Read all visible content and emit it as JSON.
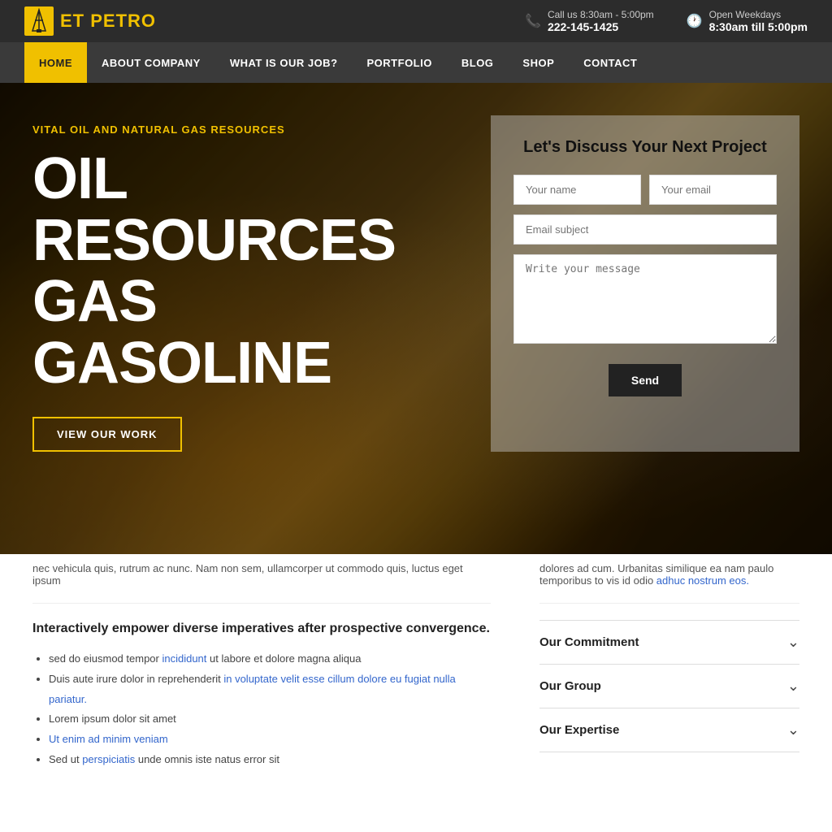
{
  "topbar": {
    "logo_prefix": "ET ",
    "logo_accent": "PETRO",
    "phone_label": "Call us 8:30am - 5:00pm",
    "phone_number": "222-145-1425",
    "hours_label": "Open Weekdays",
    "hours_value": "8:30am till 5:00pm"
  },
  "nav": {
    "items": [
      {
        "label": "HOME",
        "active": true
      },
      {
        "label": "ABOUT COMPANY",
        "active": false
      },
      {
        "label": "WHAT IS OUR JOB?",
        "active": false
      },
      {
        "label": "PORTFOLIO",
        "active": false
      },
      {
        "label": "BLOG",
        "active": false
      },
      {
        "label": "SHOP",
        "active": false
      },
      {
        "label": "CONTACT",
        "active": false
      }
    ]
  },
  "hero": {
    "subtitle": "VITAL OIL AND NATURAL GAS RESOURCES",
    "main_line1": "OIL",
    "main_line2": "RESOURCES",
    "main_line3": "GAS",
    "main_line4": "GASOLINE",
    "cta_label": "VIEW OUR WORK"
  },
  "contact_form": {
    "title": "Let's Discuss Your Next Project",
    "name_placeholder": "Your name",
    "email_placeholder": "Your email",
    "subject_placeholder": "Email subject",
    "message_placeholder": "Write your message",
    "send_label": "Send"
  },
  "lower": {
    "scroll_text_left": "nec vehicula quis, rutrum ac nunc. Nam non sem, ullamcorper ut commodo quis, luctus eget ipsum",
    "scroll_text_right": "dolores ad cum. Urbanitas similique ea nam paulo temporibus to vis id odio adhuc nostrum eos.",
    "scroll_text_right_link": "adhuc nostrum eos.",
    "empowerment_text": "Interactively empower diverse imperatives after prospective convergence.",
    "bullets": [
      {
        "text": "sed do eiusmod tempor incididunt ut labore et dolore magna aliqua",
        "has_link": true,
        "link_part": "incididunt"
      },
      {
        "text": "Duis aute irure dolor in reprehenderit in voluptate velit esse cillum dolore eu fugiat nulla pariatur.",
        "has_link": true,
        "link_part": "in voluptate velit esse cillum dolore eu fugiat nulla pariatur."
      },
      {
        "text": "Lorem ipsum dolor sit amet",
        "has_link": false
      },
      {
        "text": "Ut enim ad minim veniam",
        "has_link": true,
        "link_part": "Ut enim ad minim veniam"
      },
      {
        "text": "Sed ut perspiciatis unde omnis iste natus error sit",
        "has_link": true,
        "link_part": "perspiciatis"
      }
    ],
    "accordion": [
      {
        "label": "Our Commitment"
      },
      {
        "label": "Our Group"
      },
      {
        "label": "Our Expertise"
      }
    ]
  },
  "colors": {
    "accent": "#f0c000",
    "dark": "#2c2c2c",
    "nav_bg": "#3a3a3a"
  }
}
